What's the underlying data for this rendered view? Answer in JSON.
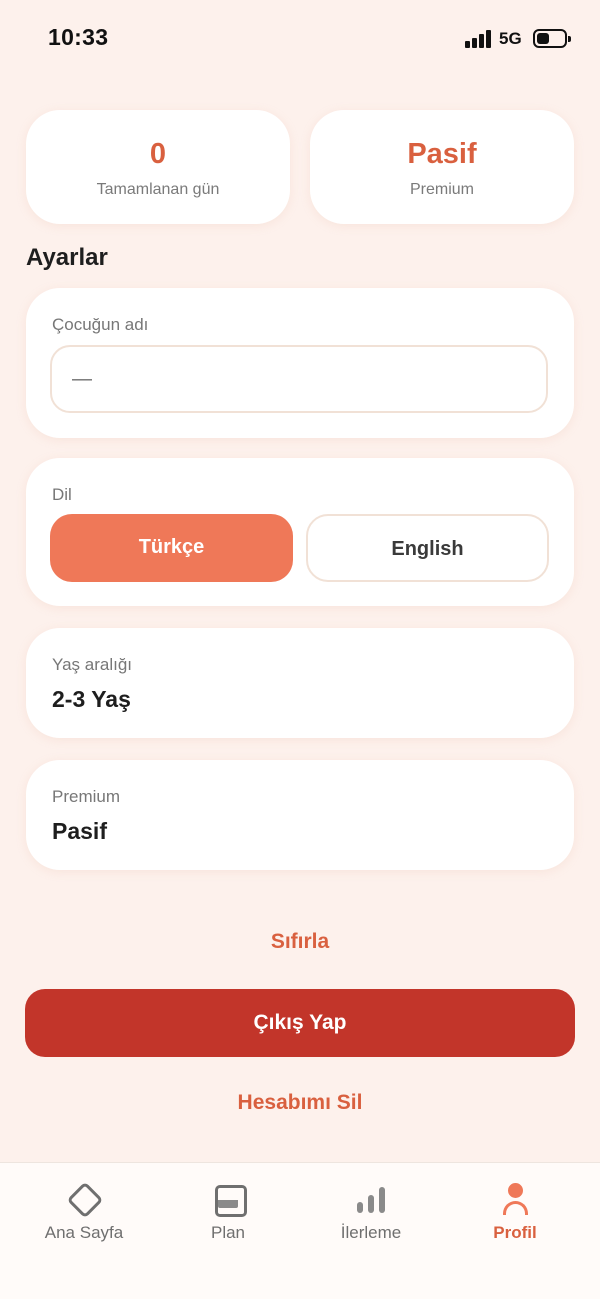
{
  "status_bar": {
    "time": "10:33",
    "network": "5G"
  },
  "stats": {
    "days": {
      "value": "0",
      "label": "Tamamlanan gün"
    },
    "premium": {
      "value": "Pasif",
      "label": "Premium"
    }
  },
  "settings": {
    "title": "Ayarlar",
    "child_name": {
      "label": "Çocuğun adı",
      "value": "—"
    },
    "language": {
      "label": "Dil",
      "options": [
        "Türkçe",
        "English"
      ],
      "selected": "Türkçe"
    },
    "age_range": {
      "label": "Yaş aralığı",
      "value": "2-3 Yaş"
    },
    "premium": {
      "label": "Premium",
      "value": "Pasif"
    }
  },
  "actions": {
    "reset": "Sıfırla",
    "logout": "Çıkış Yap",
    "delete_account": "Hesabımı Sil"
  },
  "tab_bar": {
    "items": [
      {
        "label": "Ana Sayfa",
        "icon": "diamond-home-icon"
      },
      {
        "label": "Plan",
        "icon": "plan-icon"
      },
      {
        "label": "İlerleme",
        "icon": "bar-chart-icon"
      },
      {
        "label": "Profil",
        "icon": "person-icon"
      }
    ],
    "active": "Profil"
  },
  "colors": {
    "accent": "#d9603f",
    "primary_button": "#ef7858",
    "danger": "#c2352a",
    "background": "#fdf1ec"
  }
}
